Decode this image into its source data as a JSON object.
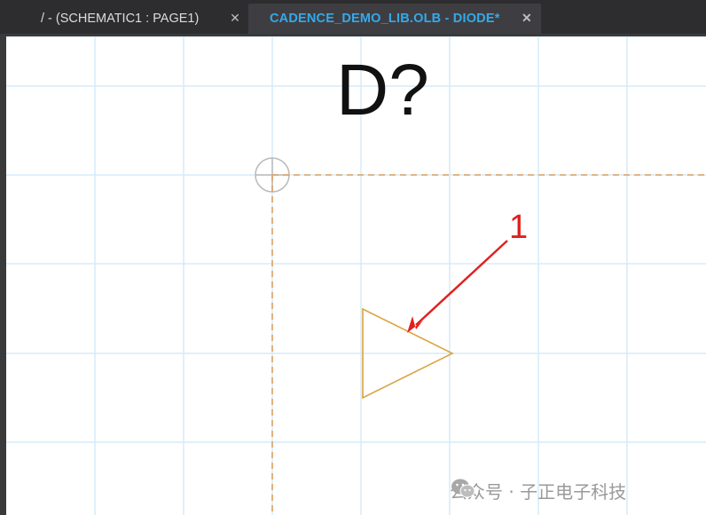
{
  "tabs": [
    {
      "label": "/ - (SCHEMATIC1 : PAGE1)",
      "close": "✕",
      "active": false
    },
    {
      "label": "CADENCE_DEMO_LIB.OLB - DIODE*",
      "close": "✕",
      "active": true
    }
  ],
  "canvas": {
    "part_reference": "D?",
    "annotation_number": "1",
    "grid_color": "#d6ebf8",
    "outline_color": "#e0a060",
    "symbol_color": "#d9a441",
    "arrow_color": "#e02020"
  },
  "watermark": {
    "text": "公众号 · 子正电子科技",
    "icon": "wechat-icon"
  }
}
